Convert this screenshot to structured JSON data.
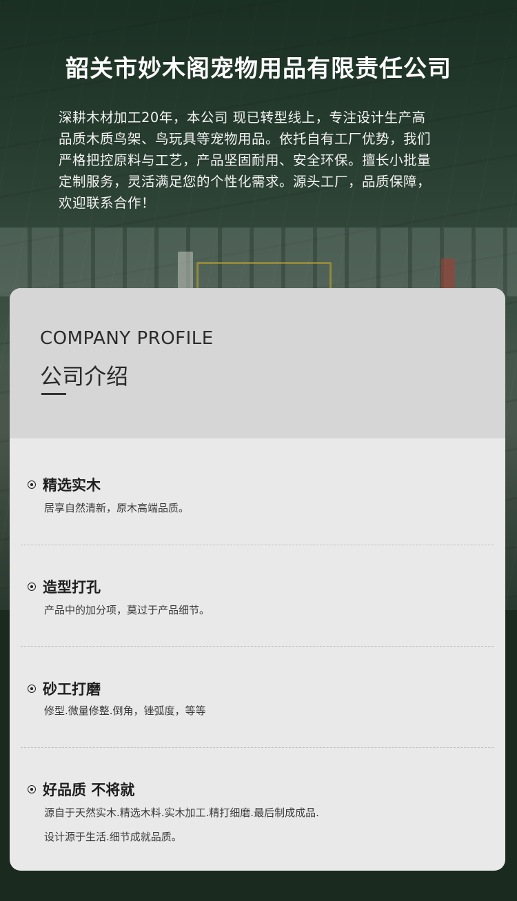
{
  "header": {
    "company_name": "韶关市妙木阁宠物用品有限责任公司",
    "intro_lines": [
      "深耕木材加工20年，本公司 现已转型线上，专注设计生产高",
      "品质木质鸟架、鸟玩具等宠物用品。依托自有工厂优势，我们",
      "严格把控原料与工艺，产品坚固耐用、安全环保。擅长小批量",
      "定制服务，灵活满足您的个性化需求。源头工厂，品质保障，",
      "欢迎联系合作！"
    ]
  },
  "profile": {
    "title_en": "COMPANY PROFILE",
    "title_cn": "公司介绍",
    "features": [
      {
        "title": "精选实木",
        "desc": [
          "居享自然清新，原木高端品质。"
        ]
      },
      {
        "title": "造型打孔",
        "desc": [
          "产品中的加分项，莫过于产品细节。"
        ]
      },
      {
        "title": "砂工打磨",
        "desc": [
          "修型.微量修整.倒角，锉弧度，等等"
        ]
      },
      {
        "title": "好品质 不将就",
        "desc": [
          "源自于天然实木.精选木料.实木加工.精打细磨.最后制成成品.",
          "设计源于生活.细节成就品质。"
        ]
      }
    ]
  },
  "colors": {
    "card_bg": "#e9e9e9",
    "card_header_bg": "#d6d6d6",
    "hero_tint": "#2c4636",
    "bottom_bg": "#1a2a1e"
  },
  "icons": {
    "bullet": "circle-dot-icon"
  }
}
